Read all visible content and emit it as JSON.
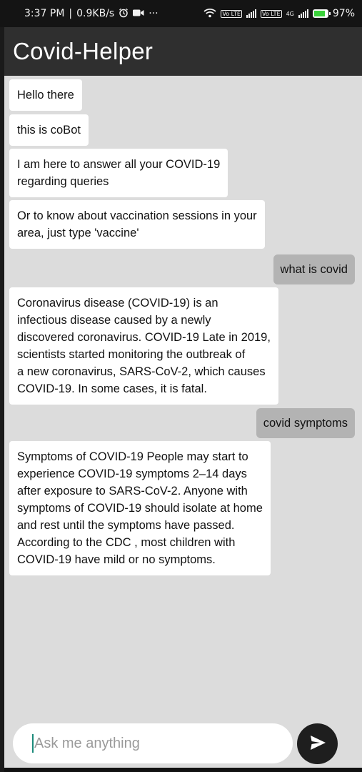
{
  "status_bar": {
    "time": "3:37 PM",
    "speed": "0.9KB/s",
    "more": "···",
    "lte1": "Vo LTE",
    "lte2": "Vo LTE",
    "network_label": "4G",
    "battery_percent": "97%",
    "battery_level": 0.97
  },
  "app": {
    "title": "Covid-Helper"
  },
  "messages": [
    {
      "sender": "bot",
      "text": "Hello there"
    },
    {
      "sender": "bot",
      "text": "this is coBot"
    },
    {
      "sender": "bot",
      "text": "I am here to answer all your COVID-19\nregarding queries"
    },
    {
      "sender": "bot",
      "text": "Or to know about vaccination sessions in your\narea, just type 'vaccine'"
    },
    {
      "sender": "user",
      "text": "what is covid"
    },
    {
      "sender": "bot",
      "text": " Coronavirus disease (COVID-19) is an\ninfectious disease caused by a newly\ndiscovered coronavirus. COVID-19 Late in 2019,\nscientists started monitoring the outbreak of\na new coronavirus, SARS-CoV-2, which causes\nCOVID-19. In some cases, it is fatal."
    },
    {
      "sender": "user",
      "text": "covid symptoms"
    },
    {
      "sender": "bot",
      "text": " Symptoms of COVID-19 People may start to\nexperience COVID-19 symptoms 2–14 days\nafter exposure to SARS-CoV-2. Anyone with\nsymptoms of COVID-19 should isolate at home\nand rest until the symptoms have passed.\nAccording to the CDC , most children with\nCOVID-19 have mild or no symptoms."
    }
  ],
  "composer": {
    "placeholder": "Ask me anything"
  },
  "icons": {
    "send": "send-icon",
    "alarm": "alarm-icon",
    "video": "video-icon",
    "wifi": "wifi-icon",
    "battery": "battery-icon"
  },
  "colors": {
    "app_bar": "#2f2f2f",
    "chat_background": "#dcdcdc",
    "bot_bubble": "#ffffff",
    "user_bubble": "#b3b3b3",
    "send_button": "#1e1e1e"
  }
}
